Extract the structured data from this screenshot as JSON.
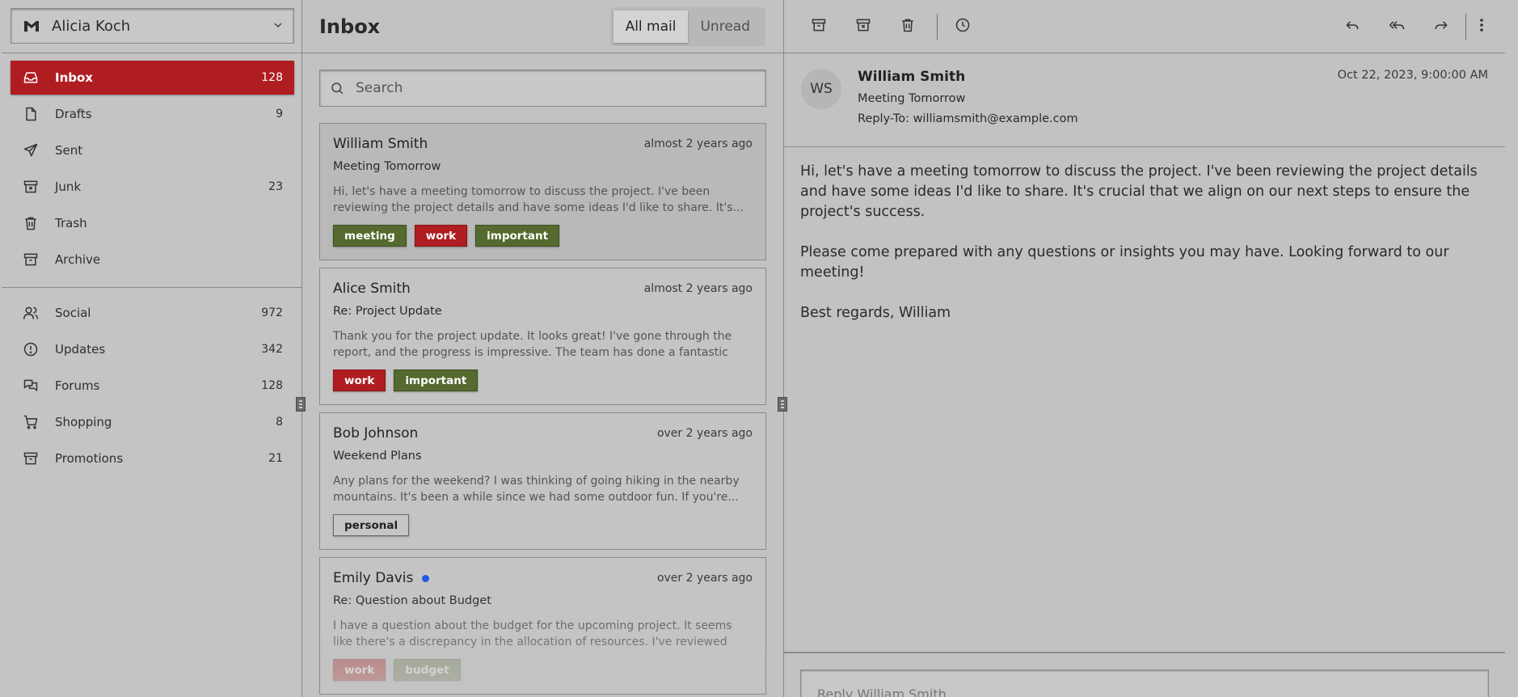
{
  "account": {
    "name": "Alicia Koch"
  },
  "nav_primary": [
    {
      "label": "Inbox",
      "count": "128",
      "icon": "inbox-icon",
      "active": true
    },
    {
      "label": "Drafts",
      "count": "9",
      "icon": "file-icon"
    },
    {
      "label": "Sent",
      "count": "",
      "icon": "send-icon"
    },
    {
      "label": "Junk",
      "count": "23",
      "icon": "archive-x-icon"
    },
    {
      "label": "Trash",
      "count": "",
      "icon": "trash-icon"
    },
    {
      "label": "Archive",
      "count": "",
      "icon": "archive-icon"
    }
  ],
  "nav_secondary": [
    {
      "label": "Social",
      "count": "972",
      "icon": "users-icon"
    },
    {
      "label": "Updates",
      "count": "342",
      "icon": "alert-circle-icon"
    },
    {
      "label": "Forums",
      "count": "128",
      "icon": "messages-icon"
    },
    {
      "label": "Shopping",
      "count": "8",
      "icon": "cart-icon"
    },
    {
      "label": "Promotions",
      "count": "21",
      "icon": "archive-icon"
    }
  ],
  "list": {
    "title": "Inbox",
    "tabs": [
      "All mail",
      "Unread"
    ],
    "search_placeholder": "Search",
    "mails": [
      {
        "from": "William Smith",
        "date": "almost 2 years ago",
        "subject": "Meeting Tomorrow",
        "preview": "Hi, let's have a meeting tomorrow to discuss the project. I've been reviewing the project details and have some ideas I'd like to share. It's...",
        "tags": [
          {
            "label": "meeting",
            "style": "green"
          },
          {
            "label": "work",
            "style": "red"
          },
          {
            "label": "important",
            "style": "green"
          }
        ],
        "unread": false
      },
      {
        "from": "Alice Smith",
        "date": "almost 2 years ago",
        "subject": "Re: Project Update",
        "preview": "Thank you for the project update. It looks great! I've gone through the report, and the progress is impressive. The team has done a fantastic job,...",
        "tags": [
          {
            "label": "work",
            "style": "red"
          },
          {
            "label": "important",
            "style": "green"
          }
        ],
        "unread": false
      },
      {
        "from": "Bob Johnson",
        "date": "over 2 years ago",
        "subject": "Weekend Plans",
        "preview": "Any plans for the weekend? I was thinking of going hiking in the nearby mountains. It's been a while since we had some outdoor fun. If you're...",
        "tags": [
          {
            "label": "personal",
            "style": "outline"
          }
        ],
        "unread": false
      },
      {
        "from": "Emily Davis",
        "date": "over 2 years ago",
        "subject": "Re: Question about Budget",
        "preview": "I have a question about the budget for the upcoming project. It seems like there's a discrepancy in the allocation of resources. I've reviewed the...",
        "tags": [
          {
            "label": "work",
            "style": "red"
          },
          {
            "label": "budget",
            "style": "green"
          }
        ],
        "unread": true
      }
    ]
  },
  "message": {
    "initials": "WS",
    "sender": "William Smith",
    "subject": "Meeting Tomorrow",
    "reply_to_label": "Reply-To:",
    "reply_to": "williamsmith@example.com",
    "date": "Oct 22, 2023, 9:00:00 AM",
    "body": [
      "Hi, let's have a meeting tomorrow to discuss the project. I've been reviewing the project details and have some ideas I'd like to share. It's crucial that we align on our next steps to ensure the project's success.",
      "Please come prepared with any questions or insights you may have. Looking forward to our meeting!",
      "Best regards, William"
    ],
    "reply_placeholder": "Reply William Smith..."
  },
  "colors": {
    "accent": "#b01d21",
    "tag_green": "#546a2e",
    "unread_dot": "#1e5ee0"
  }
}
